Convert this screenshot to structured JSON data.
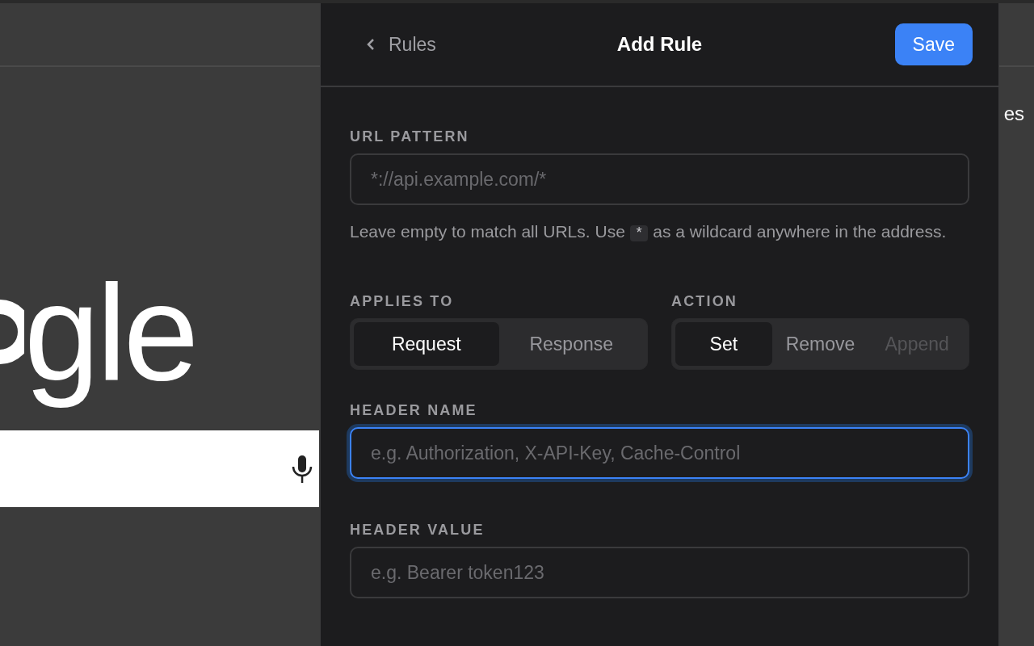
{
  "background_page": {
    "logo": "gle",
    "corner_text": "es"
  },
  "panel": {
    "back_label": "Rules",
    "title": "Add Rule",
    "save_label": "Save",
    "url_pattern": {
      "label": "URL PATTERN",
      "placeholder": "*://api.example.com/*",
      "focused": false,
      "help_before": "Leave empty to match all URLs. Use",
      "help_code": "*",
      "help_after": "as a wildcard anywhere in the address."
    },
    "applies_to": {
      "label": "APPLIES TO",
      "options": [
        {
          "label": "Request",
          "selected": true,
          "disabled": false
        },
        {
          "label": "Response",
          "selected": false,
          "disabled": false
        }
      ]
    },
    "action": {
      "label": "ACTION",
      "options": [
        {
          "label": "Set",
          "selected": true,
          "disabled": false
        },
        {
          "label": "Remove",
          "selected": false,
          "disabled": false
        },
        {
          "label": "Append",
          "selected": false,
          "disabled": true
        }
      ]
    },
    "header_name": {
      "label": "HEADER NAME",
      "placeholder": "e.g. Authorization, X-API-Key, Cache-Control",
      "focused": true
    },
    "header_value": {
      "label": "HEADER VALUE",
      "placeholder": "e.g. Bearer token123",
      "focused": false
    }
  }
}
